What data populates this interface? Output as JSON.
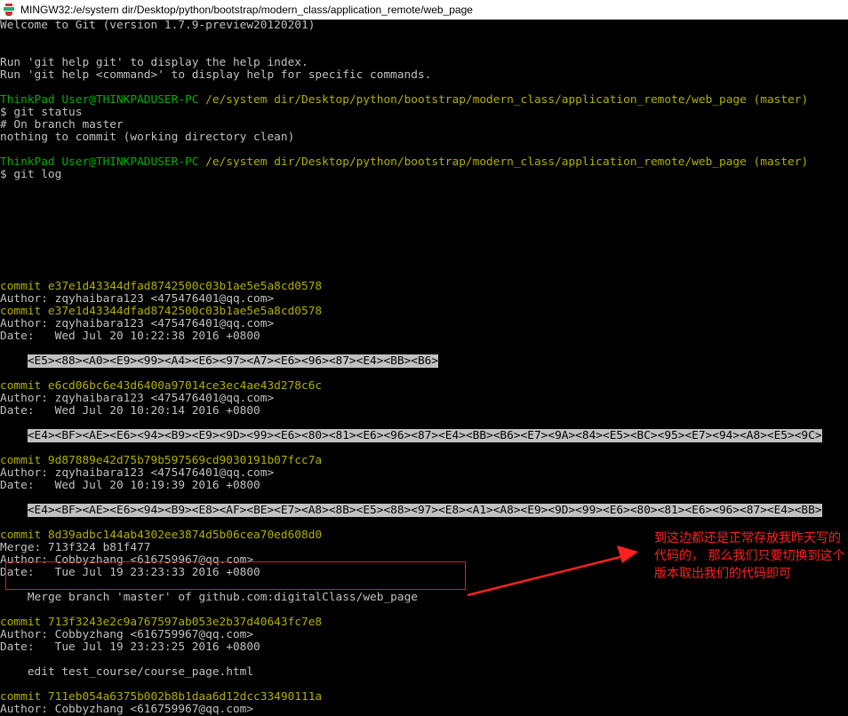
{
  "window": {
    "title": "MINGW32:/e/system dir/Desktop/python/bootstrap/modern_class/application_remote/web_page"
  },
  "terminal": {
    "welcome": "Welcome to Git (version 1.7.9-preview20120201)",
    "help1": "Run 'git help git' to display the help index.",
    "help2": "Run 'git help <command>' to display help for specific commands.",
    "prompt_user": "ThinkPad User@THINKPADUSER-PC",
    "prompt_path": "/e/system dir/Desktop/python/bootstrap/modern_class/application_remote/web_page",
    "prompt_branch": "(master)",
    "cmd1": "$ git status",
    "status1": "# On branch master",
    "status2": "nothing to commit (working directory clean)",
    "cmd2": "$ git log",
    "log": [
      {
        "commit": "commit e37e1d43344dfad8742500c03b1ae5e5a8cd0578",
        "author": "Author: zqyhaibara123 <475476401@qq.com>"
      },
      {
        "commit": "commit e37e1d43344dfad8742500c03b1ae5e5a8cd0578",
        "author": "Author: zqyhaibara123 <475476401@qq.com>",
        "date": "Date:   Wed Jul 20 10:22:38 2016 +0800",
        "message": "<E5><88><A0><E9><99><A4><E6><97><A7><E6><96><87><E4><BB><B6>"
      },
      {
        "commit": "commit e6cd06bc6e43d6400a97014ce3ec4ae43d278c6c",
        "author": "Author: zqyhaibara123 <475476401@qq.com>",
        "date": "Date:   Wed Jul 20 10:20:14 2016 +0800",
        "message": "<E4><BF><AE><E6><94><B9><E9><9D><99><E6><80><81><E6><96><87><E4><BB><B6><E7><9A><84><E5><BC><95><E7><94><A8><E5><9C>"
      },
      {
        "commit": "commit 9d87889e42d75b79b597569cd9030191b07fcc7a",
        "author": "Author: zqyhaibara123 <475476401@qq.com>",
        "date": "Date:   Wed Jul 20 10:19:39 2016 +0800",
        "message": "<E4><BF><AE><E6><94><B9><E8><AF><BE><E7><A8><8B><E5><88><97><E8><A1><A8><E9><9D><99><E6><80><81><E6><96><87><E4><BB>"
      },
      {
        "commit": "commit 8d39adbc144ab4302ee3874d5b06cea70ed608d0",
        "merge": "Merge: 713f324 b81f477",
        "author": "Author: Cobbyzhang <616759967@qq.com>",
        "date": "Date:   Tue Jul 19 23:23:33 2016 +0800",
        "message": "Merge branch 'master' of github.com:digitalClass/web_page"
      },
      {
        "commit": "commit 713f3243e2c9a767597ab053e2b37d40643fc7e8",
        "author": "Author: Cobbyzhang <616759967@qq.com>",
        "date": "Date:   Tue Jul 19 23:23:25 2016 +0800",
        "message": "edit test_course/course_page.html"
      },
      {
        "commit": "commit 711eb054a6375b002b8b1daa6d12dcc33490111a",
        "author": "Author: Cobbyzhang <616759967@qq.com>"
      }
    ]
  },
  "annotation": {
    "note": "到这边都还是正常存放我昨天写的代码的， 那么我们只要切换到这个版本取出我们的代码即可",
    "color": "#ff2020"
  }
}
